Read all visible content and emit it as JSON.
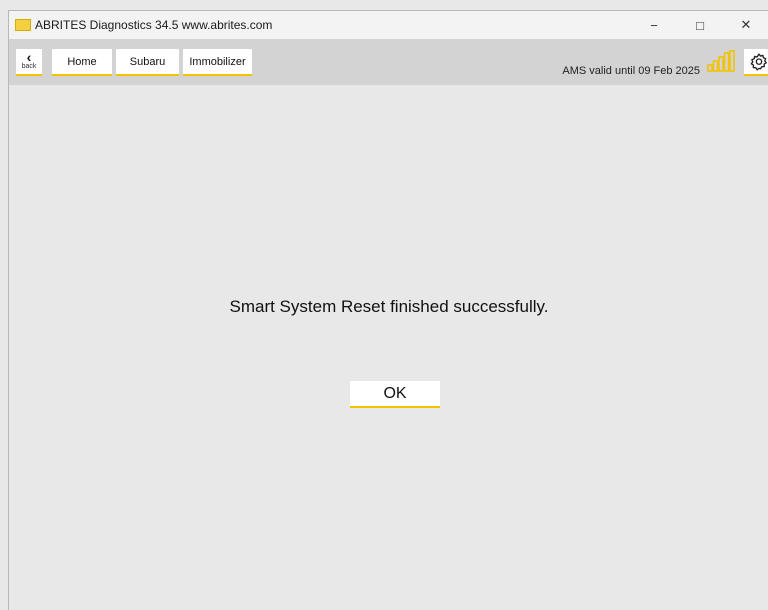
{
  "window": {
    "title": "ABRITES Diagnostics 34.5   www.abrites.com",
    "app_icon": "abrites-logo-icon",
    "controls": {
      "minimize": "−",
      "maximize": "□",
      "close": "✕"
    }
  },
  "toolbar": {
    "back_icon": "chevron-left-icon",
    "back_label": "back",
    "breadcrumbs": [
      "Home",
      "Subaru",
      "Immobilizer"
    ],
    "ams_status": "AMS valid until 09 Feb 2025",
    "signal_icon": "signal-strength-icon",
    "signal_bars_active": 4,
    "signal_bars_total": 5,
    "settings_icon": "gear-icon"
  },
  "dialog": {
    "message": "Smart System Reset finished successfully.",
    "ok_label": "OK"
  },
  "colors": {
    "accent": "#f2c200",
    "background": "#e8e8e8",
    "toolbar": "#d3d3d3",
    "titlebar": "#f3f3f3"
  }
}
